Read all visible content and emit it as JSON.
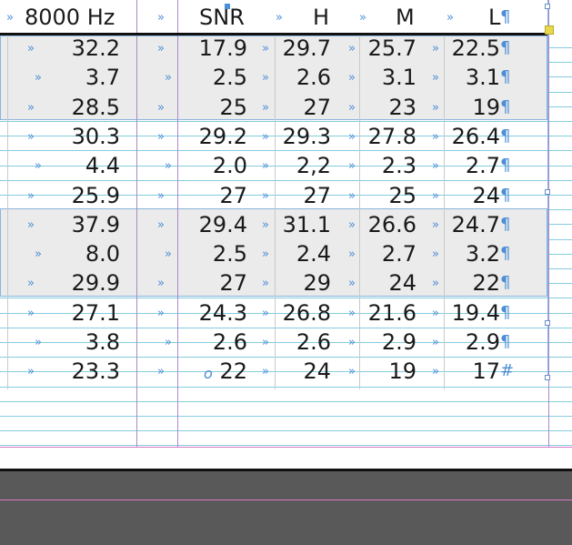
{
  "table": {
    "headers": {
      "hz": "8000 Hz",
      "snr": "SNR",
      "h": "H",
      "m": "M",
      "l": "L"
    },
    "rows": [
      {
        "hz": "32.2",
        "snr": "17.9",
        "h": "29.7",
        "m": "25.7",
        "l": "22.5",
        "end": "¶"
      },
      {
        "hz": "3.7",
        "snr": "2.5",
        "h": "2.6",
        "m": "3.1",
        "l": "3.1",
        "end": "¶"
      },
      {
        "hz": "28.5",
        "snr": "25",
        "h": "27",
        "m": "23",
        "l": "19",
        "end": "¶"
      },
      {
        "hz": "30.3",
        "snr": "29.2",
        "h": "29.3",
        "m": "27.8",
        "l": "26.4",
        "end": "¶"
      },
      {
        "hz": "4.4",
        "snr": "2.0",
        "h": "2,2",
        "m": "2.3",
        "l": "2.7",
        "end": "¶"
      },
      {
        "hz": "25.9",
        "snr": "27",
        "h": "27",
        "m": "25",
        "l": "24",
        "end": "¶"
      },
      {
        "hz": "37.9",
        "snr": "29.4",
        "h": "31.1",
        "m": "26.6",
        "l": "24.7",
        "end": "¶"
      },
      {
        "hz": "8.0",
        "snr": "2.5",
        "h": "2.4",
        "m": "2.7",
        "l": "3.2",
        "end": "¶"
      },
      {
        "hz": "29.9",
        "snr": "27",
        "h": "29",
        "m": "24",
        "l": "22",
        "end": "¶"
      },
      {
        "hz": "27.1",
        "snr": "24.3",
        "h": "26.8",
        "m": "21.6",
        "l": "19.4",
        "end": "¶"
      },
      {
        "hz": "3.8",
        "snr": "2.6",
        "h": "2.6",
        "m": "2.9",
        "l": "2.9",
        "end": "¶"
      },
      {
        "hz": "23.3",
        "snr": "22",
        "h": "24",
        "m": "19",
        "l": "17",
        "end": "#"
      }
    ]
  },
  "marks": {
    "tab": "»",
    "pilcrow": "¶",
    "anchor": "o"
  },
  "colors": {
    "shade": "#ebebeb",
    "guide_blue": "#4d8fd6",
    "column_guide": "#a98ac8",
    "pasteboard": "#595959"
  }
}
